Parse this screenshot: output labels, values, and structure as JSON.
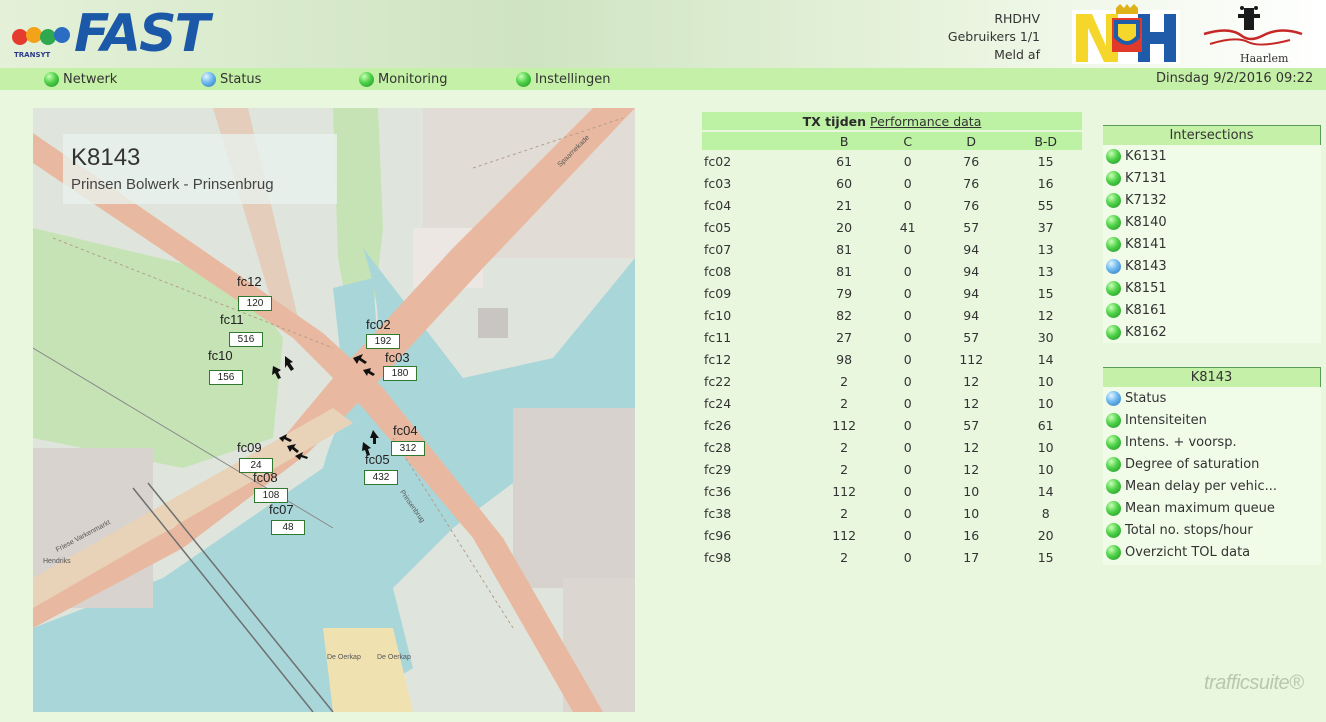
{
  "header": {
    "logo_text": "FAST",
    "logo_sub": "TRANSYT",
    "user": "RHDHV",
    "users_label": "Gebruikers  1/1",
    "logout_label": "Meld af",
    "haarlem_label": "Haarlem",
    "nh_logo_icon": "noord-holland-logo",
    "haarlem_logo_icon": "haarlem-logo"
  },
  "nav": {
    "items": [
      {
        "label": "Netwerk",
        "status": "green"
      },
      {
        "label": "Status",
        "status": "blue"
      },
      {
        "label": "Monitoring",
        "status": "green"
      },
      {
        "label": "Instellingen",
        "status": "green"
      }
    ],
    "datetime": "Dinsdag 9/2/2016 09:22"
  },
  "map": {
    "intersection_id": "K8143",
    "intersection_name": "Prinsen Bolwerk - Prinsenbrug",
    "signals": [
      {
        "label": "fc12",
        "value": "120"
      },
      {
        "label": "fc11",
        "value": "516"
      },
      {
        "label": "fc10",
        "value": "156"
      },
      {
        "label": "fc02",
        "value": "192"
      },
      {
        "label": "fc03",
        "value": "180"
      },
      {
        "label": "fc04",
        "value": "312"
      },
      {
        "label": "fc05",
        "value": "432"
      },
      {
        "label": "fc09",
        "value": "24"
      },
      {
        "label": "fc08",
        "value": "108"
      },
      {
        "label": "fc07",
        "value": "48"
      }
    ],
    "street_labels": [
      "Spaarnekade",
      "Friese Varkenmarkt",
      "Prinsenbrug",
      "Hendriks",
      "De Oerkap",
      "De Oerkap"
    ]
  },
  "tx_table": {
    "title": "TX tijden",
    "link": "Performance data",
    "columns": [
      "",
      "B",
      "C",
      "D",
      "B-D"
    ],
    "rows": [
      [
        "fc02",
        "61",
        "0",
        "76",
        "15"
      ],
      [
        "fc03",
        "60",
        "0",
        "76",
        "16"
      ],
      [
        "fc04",
        "21",
        "0",
        "76",
        "55"
      ],
      [
        "fc05",
        "20",
        "41",
        "57",
        "37"
      ],
      [
        "fc07",
        "81",
        "0",
        "94",
        "13"
      ],
      [
        "fc08",
        "81",
        "0",
        "94",
        "13"
      ],
      [
        "fc09",
        "79",
        "0",
        "94",
        "15"
      ],
      [
        "fc10",
        "82",
        "0",
        "94",
        "12"
      ],
      [
        "fc11",
        "27",
        "0",
        "57",
        "30"
      ],
      [
        "fc12",
        "98",
        "0",
        "112",
        "14"
      ],
      [
        "fc22",
        "2",
        "0",
        "12",
        "10"
      ],
      [
        "fc24",
        "2",
        "0",
        "12",
        "10"
      ],
      [
        "fc26",
        "112",
        "0",
        "57",
        "61"
      ],
      [
        "fc28",
        "2",
        "0",
        "12",
        "10"
      ],
      [
        "fc29",
        "2",
        "0",
        "12",
        "10"
      ],
      [
        "fc36",
        "112",
        "0",
        "10",
        "14"
      ],
      [
        "fc38",
        "2",
        "0",
        "10",
        "8"
      ],
      [
        "fc96",
        "112",
        "0",
        "16",
        "20"
      ],
      [
        "fc98",
        "2",
        "0",
        "17",
        "15"
      ]
    ]
  },
  "intersections": {
    "title": "Intersections",
    "items": [
      {
        "label": "K6131",
        "status": "green"
      },
      {
        "label": "K7131",
        "status": "green"
      },
      {
        "label": "K7132",
        "status": "green"
      },
      {
        "label": "K8140",
        "status": "green"
      },
      {
        "label": "K8141",
        "status": "green"
      },
      {
        "label": "K8143",
        "status": "blue"
      },
      {
        "label": "K8151",
        "status": "green"
      },
      {
        "label": "K8161",
        "status": "green"
      },
      {
        "label": "K8162",
        "status": "green"
      }
    ]
  },
  "intersection_menu": {
    "title": "K8143",
    "items": [
      {
        "label": "Status",
        "status": "blue"
      },
      {
        "label": "Intensiteiten",
        "status": "green"
      },
      {
        "label": "Intens. + voorsp.",
        "status": "green"
      },
      {
        "label": "Degree of saturation",
        "status": "green"
      },
      {
        "label": "Mean delay per vehic...",
        "status": "green"
      },
      {
        "label": "Mean maximum queue",
        "status": "green"
      },
      {
        "label": "Total no. stops/hour",
        "status": "green"
      },
      {
        "label": "Overzicht TOL data",
        "status": "green"
      }
    ]
  },
  "footer": {
    "brand": "trafficsuite®"
  },
  "colors": {
    "background": "#e9f7df",
    "nav_bar": "#c5f0a8",
    "status_green": "#4ed248",
    "status_blue": "#6cb8ee",
    "water": "#a9d6d9",
    "road": "#e8b9a0"
  }
}
